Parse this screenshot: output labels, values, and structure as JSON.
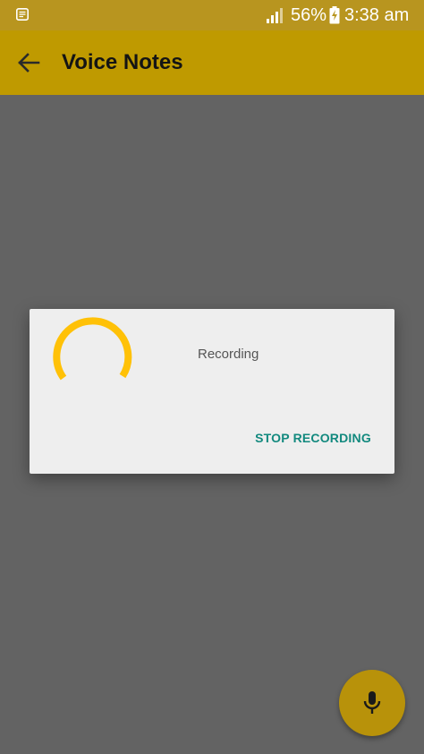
{
  "status_bar": {
    "battery_percent": "56%",
    "time": "3:38 am",
    "notification_icon": "notification-icon",
    "signal_icon": "signal-icon",
    "battery_icon": "battery-charging-icon"
  },
  "app_bar": {
    "title": "Voice Notes",
    "back_icon": "arrow-back-icon",
    "color": "#bf9a00"
  },
  "dialog": {
    "message": "Recording",
    "stop_button_label": "STOP RECORDING",
    "spinner_color": "#ffc107",
    "button_color": "#12897e"
  },
  "fab": {
    "icon": "microphone-icon",
    "color": "#b8920a"
  }
}
